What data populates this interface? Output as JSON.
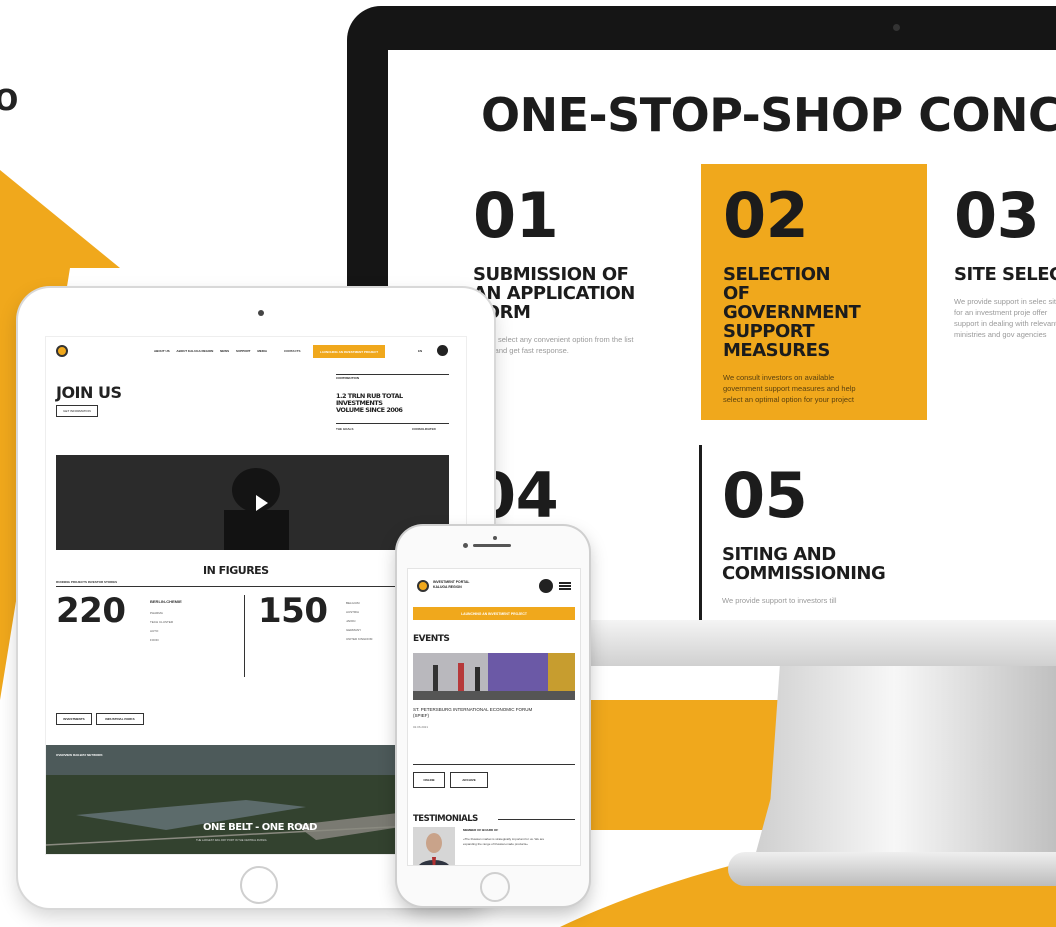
{
  "brand": {
    "accent": "#f0a81c",
    "dark": "#151515"
  },
  "edge_glyph": "o",
  "monitor": {
    "title": "ONE-STOP-SHOP CONCEPT",
    "steps": [
      {
        "number": "01",
        "heading": "SUBMISSION OF AN APPLICATION FORM",
        "description": "Please select any convenient option from the list below and get fast response."
      },
      {
        "number": "02",
        "heading": "SELECTION OF GOVERNMENT SUPPORT MEASURES",
        "description": "We consult investors on available government support measures and help select an optimal option for your project"
      },
      {
        "number": "03",
        "heading": "SITE SELECTI",
        "description": "We provide support in selec site for an investment proje offer support in dealing with relevant ministries and gov agencies"
      },
      {
        "number": "04",
        "heading": "",
        "description": ""
      },
      {
        "number": "05",
        "heading": "SITING AND COMMISSIONING",
        "description": "We provide support to investors till"
      }
    ]
  },
  "tablet": {
    "nav": [
      "ABOUT US",
      "ABOUT KALUGA REGION",
      "NEWS",
      "SUPPORT",
      "MEDIA"
    ],
    "contacts": "CONTACTS",
    "cta": "LAUNCHING AN INVESTMENT PROJECT",
    "lang": "EN",
    "heading": "JOIN US",
    "join_button": "GET INFORMATION",
    "figures_tabs": "CONTRIBUTION",
    "investment_figure": "1.2 TRLN RUB TOTAL INVESTMENTS VOLUME SINCE 2006",
    "figures_sub_left": "THE GOALS",
    "figures_sub_right": "CONSOLIDATED",
    "in_figures": "IN FIGURES",
    "tabs_left": "RUNNING PROJECTS    INVESTOR STORIES",
    "big_left": "220",
    "company": "BERLIN-CHEMIE",
    "big_right": "150",
    "list_left": [
      "PHARMA",
      "TECH CLUSTER",
      "AUTO",
      "FOOD"
    ],
    "list_right": [
      "BELGIUM",
      "AUSTRIA",
      "JAPAN",
      "GERMANY",
      "UNITED KINGDOM"
    ],
    "btn1": "INVESTMENTS",
    "btn2": "INDUSTRIAL PARKS",
    "aerial_tabs": "OVERVIEW    RAILWAY NETWORK",
    "belt_title": "ONE BELT - ONE ROAD",
    "belt_sub": "THE LARGEST RAIL DRY PORT IN THE CENTRAL RUSSIA"
  },
  "phone": {
    "brand": "INVESTMENT PORTAL KALUGA REGION",
    "cta": "LAUNCHING AN INVESTMENT PROJECT",
    "events_title": "EVENTS",
    "event_title": "ST. PETERSBURG INTERNATIONAL ECONOMIC FORUM (SPIEF)",
    "event_date": "02.06.2021",
    "btn1": "ONLINE",
    "btn2": "ARCHIVE",
    "testimonials_title": "TESTIMONIALS",
    "testi_person": "MEMBER OF BOARD OF",
    "testi_quote": "«The Russian market is strategically important for us. We are expanding the range of Russian-made products»"
  }
}
